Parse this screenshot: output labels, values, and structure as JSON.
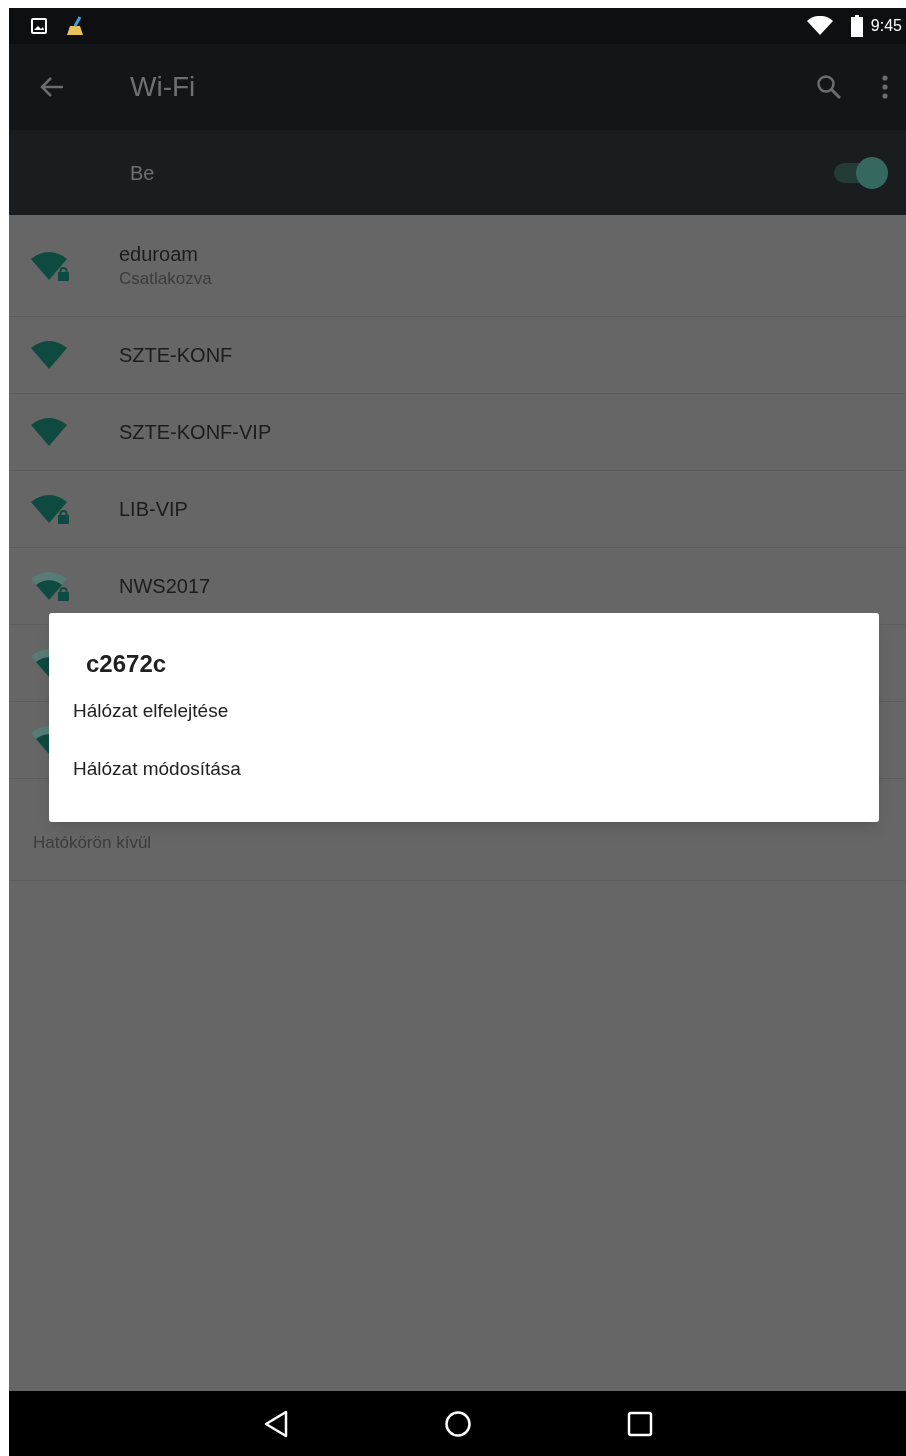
{
  "status_bar": {
    "time": "9:45"
  },
  "toolbar": {
    "title": "Wi-Fi"
  },
  "master_switch": {
    "label": "Be",
    "on": true
  },
  "networks": [
    {
      "name": "eduroam",
      "status": "Csatlakozva",
      "kind": "full",
      "locked": true
    },
    {
      "name": "SZTE-KONF",
      "kind": "full",
      "locked": false
    },
    {
      "name": "SZTE-KONF-VIP",
      "kind": "full",
      "locked": false
    },
    {
      "name": "LIB-VIP",
      "kind": "full",
      "locked": true
    },
    {
      "name": "NWS2017",
      "kind": "medium",
      "locked": true
    },
    {
      "kind": "medium"
    },
    {
      "kind": "medium"
    },
    {
      "status": "Hatókörön kívül",
      "kind": "none"
    }
  ],
  "dialog": {
    "title": "c2672c",
    "items": [
      "Hálózat elfelejtése",
      "Hálózat módosítása"
    ]
  }
}
